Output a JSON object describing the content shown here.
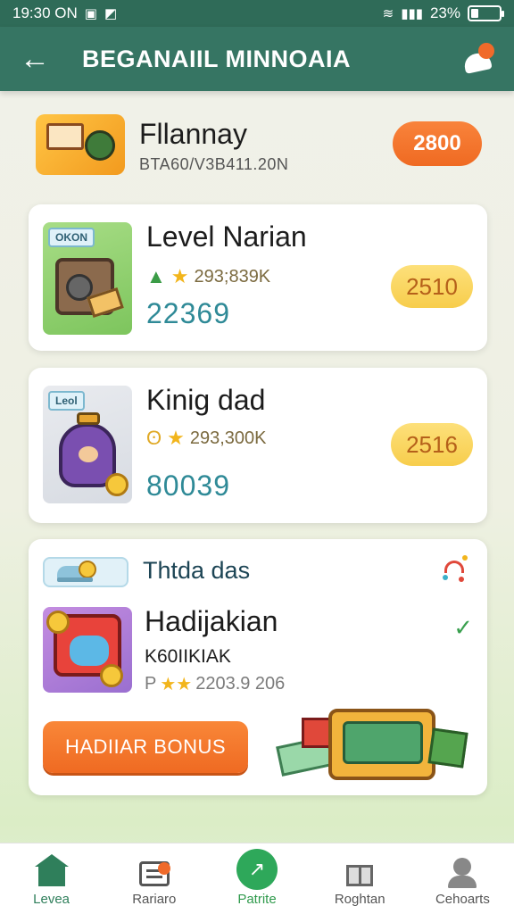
{
  "status_bar": {
    "time": "19:30 ON",
    "battery": "23%"
  },
  "header": {
    "title": "BEGANAIIL MINNOAIA",
    "notification_badge": ""
  },
  "summary": {
    "title": "Fllannay",
    "subtitle": "BTA60/V3B411.20N",
    "badge": "2800"
  },
  "cards": [
    {
      "tag": "OKON",
      "title": "Level Narian",
      "stat": "293;839K",
      "value": "22369",
      "badge": "2510"
    },
    {
      "tag": "Leol",
      "title": "Kinig dad",
      "stat": "293,300K",
      "value": "80039",
      "badge": "2516"
    }
  ],
  "promo": {
    "label": "Thtda das",
    "title": "Hadijakian",
    "subtitle": "K60IIKIAK",
    "stat_prefix": "P",
    "stat": "2203.9 206",
    "button": "HADIIAR BONUS"
  },
  "bottom_nav": [
    {
      "label": "Levea",
      "icon": "home-icon"
    },
    {
      "label": "Rariaro",
      "icon": "list-icon"
    },
    {
      "label": "Patrite",
      "icon": "chart-icon"
    },
    {
      "label": "Roghtan",
      "icon": "gift-icon"
    },
    {
      "label": "Cehoarts",
      "icon": "person-icon"
    }
  ],
  "colors": {
    "header": "#367563",
    "accent_orange": "#ef6a22",
    "badge_yellow": "#f7cd4c",
    "value_teal": "#2f8a97",
    "nav_active": "#2f7f5b"
  }
}
